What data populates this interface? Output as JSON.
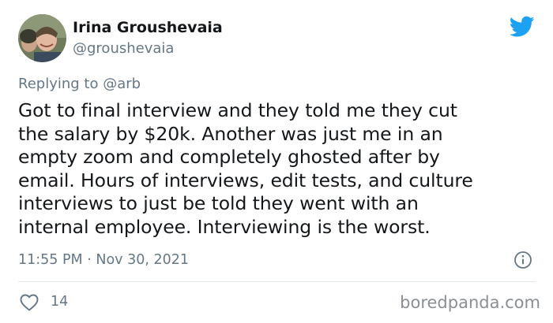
{
  "user": {
    "display_name": "Irina Groushevaia",
    "handle": "@groushevaia"
  },
  "reply": {
    "prefix": "Replying to ",
    "mention": "@arb"
  },
  "tweet": {
    "text": "Got to final interview and they told me they cut\nthe salary by $20k. Another was just me in an\nempty zoom and completely ghosted after by\nemail. Hours of interviews, edit tests, and culture\ninterviews to just be told they went with an\ninternal employee. Interviewing is the worst.",
    "time": "11:55 PM",
    "separator": " · ",
    "date": "Nov 30, 2021"
  },
  "actions": {
    "like_count": "14"
  },
  "watermark": {
    "text": "boredpanda.com"
  },
  "colors": {
    "twitter_blue": "#1da1f2",
    "secondary_text": "#657786",
    "primary_text": "#14171a"
  },
  "icons": {
    "brand": "twitter-bird-icon",
    "info": "info-icon",
    "like": "heart-icon"
  }
}
